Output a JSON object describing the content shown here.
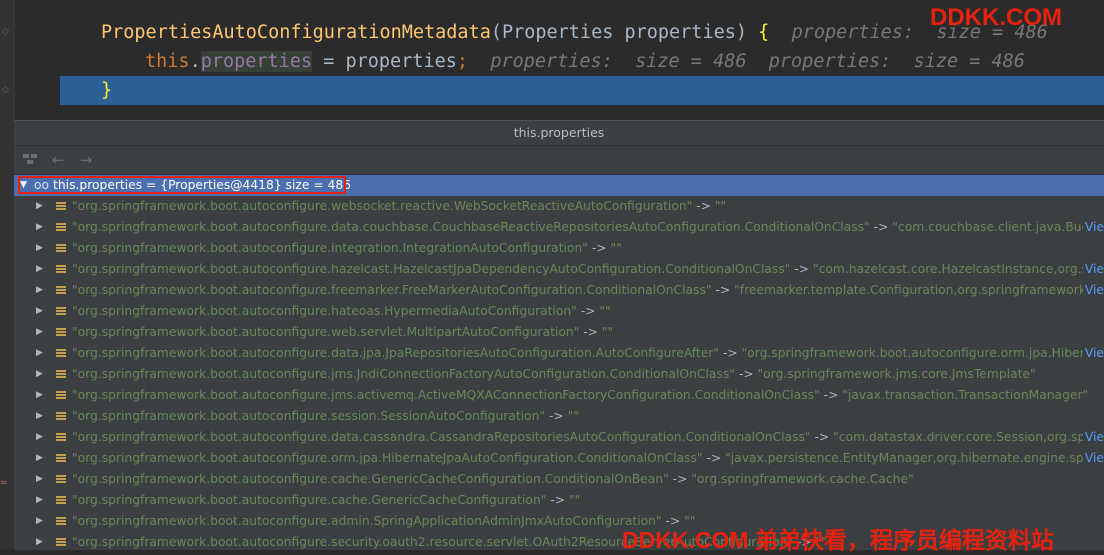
{
  "watermark_top": "DDKK.COM",
  "watermark_bottom": "DDKK.COM 弟弟快看，程序员编程资料站",
  "editor": {
    "line1": {
      "method": "PropertiesAutoConfigurationMetadata",
      "params": "(Properties properties) ",
      "brace": "{",
      "hint": "properties:  size = 486"
    },
    "line2": {
      "this": "this",
      "dot": ".",
      "field": "properties",
      "assign": " = properties",
      "semi": ";",
      "hint": "properties:  size = 486  properties:  size = 486"
    },
    "line3": {
      "brace": "}"
    }
  },
  "popup": {
    "title": "this.properties",
    "toolbar": {
      "back": "←",
      "forward": "→"
    },
    "root": {
      "label": "this.properties = {Properties@4418}  size = 486"
    },
    "view_label": "Vie",
    "entries": [
      {
        "key": "\"org.springframework.boot.autoconfigure.websocket.reactive.WebSocketReactiveAutoConfiguration\"",
        "value": "\"\"",
        "view": false
      },
      {
        "key": "\"org.springframework.boot.autoconfigure.data.couchbase.CouchbaseReactiveRepositoriesAutoConfiguration.ConditionalOnClass\"",
        "value": "\"com.couchbase.client.java.Bucket,reac...",
        "view": true
      },
      {
        "key": "\"org.springframework.boot.autoconfigure.integration.IntegrationAutoConfiguration\"",
        "value": "\"\"",
        "view": false
      },
      {
        "key": "\"org.springframework.boot.autoconfigure.hazelcast.HazelcastJpaDependencyAutoConfiguration.ConditionalOnClass\"",
        "value": "\"com.hazelcast.core.HazelcastInstance,org.springfra...",
        "view": true
      },
      {
        "key": "\"org.springframework.boot.autoconfigure.freemarker.FreeMarkerAutoConfiguration.ConditionalOnClass\"",
        "value": "\"freemarker.template.Configuration,org.springframework.ui.fre...",
        "view": true
      },
      {
        "key": "\"org.springframework.boot.autoconfigure.hateoas.HypermediaAutoConfiguration\"",
        "value": "\"\"",
        "view": false
      },
      {
        "key": "\"org.springframework.boot.autoconfigure.web.servlet.MultipartAutoConfiguration\"",
        "value": "\"\"",
        "view": false
      },
      {
        "key": "\"org.springframework.boot.autoconfigure.data.jpa.JpaRepositoriesAutoConfiguration.AutoConfigureAfter\"",
        "value": "\"org.springframework.boot.autoconfigure.orm.jpa.HibernateJ...",
        "view": true
      },
      {
        "key": "\"org.springframework.boot.autoconfigure.jms.JndiConnectionFactoryAutoConfiguration.ConditionalOnClass\"",
        "value": "\"org.springframework.jms.core.JmsTemplate\"",
        "view": false
      },
      {
        "key": "\"org.springframework.boot.autoconfigure.jms.activemq.ActiveMQXAConnectionFactoryConfiguration.ConditionalOnClass\"",
        "value": "\"javax.transaction.TransactionManager\"",
        "view": false
      },
      {
        "key": "\"org.springframework.boot.autoconfigure.session.SessionAutoConfiguration\"",
        "value": "\"\"",
        "view": false
      },
      {
        "key": "\"org.springframework.boot.autoconfigure.data.cassandra.CassandraRepositoriesAutoConfiguration.ConditionalOnClass\"",
        "value": "\"com.datastax.driver.core.Session,org.springfra...",
        "view": true
      },
      {
        "key": "\"org.springframework.boot.autoconfigure.orm.jpa.HibernateJpaAutoConfiguration.ConditionalOnClass\"",
        "value": "\"javax.persistence.EntityManager,org.hibernate.engine.spi.Session...",
        "view": true
      },
      {
        "key": "\"org.springframework.boot.autoconfigure.cache.GenericCacheConfiguration.ConditionalOnBean\"",
        "value": "\"org.springframework.cache.Cache\"",
        "view": false
      },
      {
        "key": "\"org.springframework.boot.autoconfigure.cache.GenericCacheConfiguration\"",
        "value": "\"\"",
        "view": false
      },
      {
        "key": "\"org.springframework.boot.autoconfigure.admin.SpringApplicationAdminJmxAutoConfiguration\"",
        "value": "\"\"",
        "view": false
      },
      {
        "key": "\"org.springframework.boot.autoconfigure.security.oauth2.resource.servlet.OAuth2ResourceServerAutoConfiguration\"",
        "value": "\"\"",
        "view": false
      }
    ],
    "arrow_sep": " -> "
  },
  "colors": {
    "background": "#2b2b2b",
    "selection": "#4b6eaf",
    "current_line": "#2d6099",
    "string": "#6a8759",
    "watermark": "#e8210f",
    "highlight_box": "#e8210f"
  }
}
